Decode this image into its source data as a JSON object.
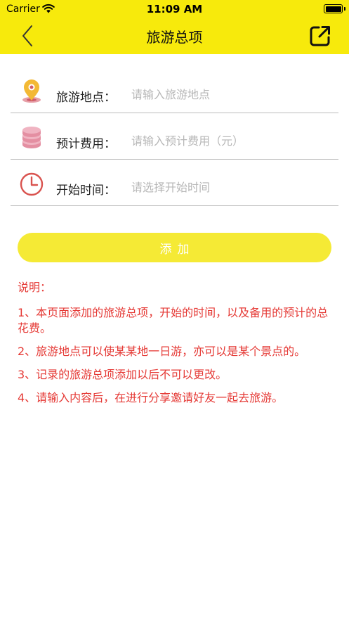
{
  "status_bar": {
    "carrier": "Carrier",
    "time": "11:09 AM"
  },
  "nav": {
    "title": "旅游总项",
    "back_icon": "chevron-left-icon",
    "share_icon": "share-external-icon"
  },
  "form": {
    "rows": [
      {
        "label": "旅游地点：",
        "placeholder": "请输入旅游地点",
        "value": "",
        "icon": "location-pin-icon"
      },
      {
        "label": "预计费用：",
        "placeholder": "请输入预计费用（元）",
        "value": "",
        "icon": "coin-stack-icon"
      },
      {
        "label": "开始时间：",
        "placeholder": "请选择开始时间",
        "value": "",
        "icon": "clock-icon"
      }
    ]
  },
  "add_button": {
    "label": "添加"
  },
  "notes": {
    "title": "说明：",
    "items": [
      "1、本页面添加的旅游总项，开始的时间，以及备用的预计的总花费。",
      "2、旅游地点可以使某某地一日游，亦可以是某个景点的。",
      "3、记录的旅游总项添加以后不可以更改。",
      "4、请输入内容后，在进行分享邀请好友一起去旅游。"
    ]
  },
  "colors": {
    "header_bg": "#f7ea0c",
    "button_bg": "#f5ea35",
    "note_text": "#e53935"
  }
}
